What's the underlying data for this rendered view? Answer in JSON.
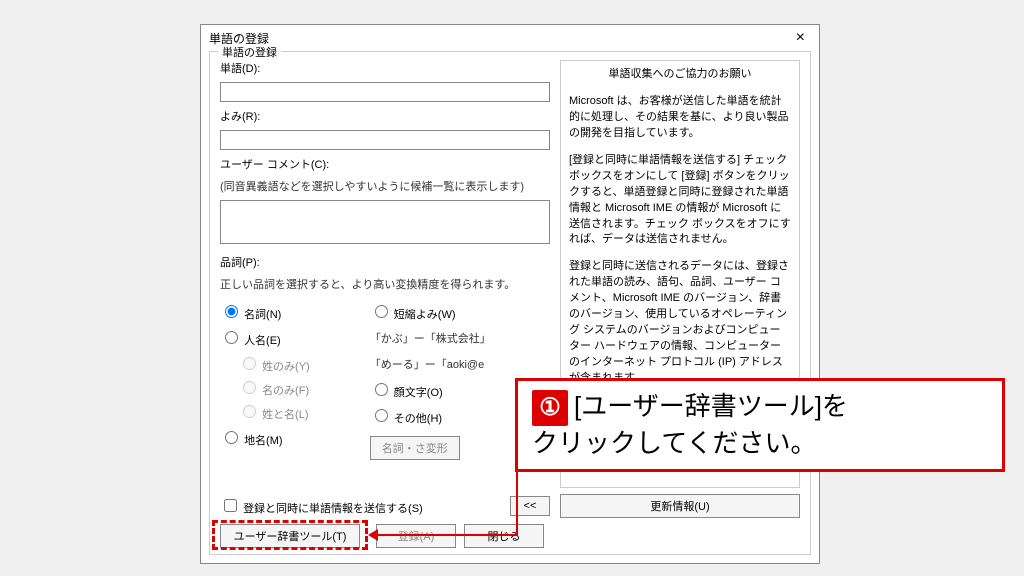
{
  "dialog": {
    "title": "単語の登録",
    "group_title": "単語の登録",
    "word_label": "単語(D):",
    "word_value": "",
    "reading_label": "よみ(R):",
    "reading_value": "",
    "comment_label": "ユーザー コメント(C):",
    "comment_hint": "(同音異義語などを選択しやすいように候補一覧に表示します)",
    "comment_value": "",
    "pos_label": "品詞(P):",
    "pos_hint": "正しい品詞を選択すると、より高い変換精度を得られます。",
    "pos": {
      "noun": "名詞(N)",
      "person": "人名(E)",
      "surname_only": "姓のみ(Y)",
      "given_only": "名のみ(F)",
      "full_name": "姓と名(L)",
      "place": "地名(M)",
      "short": "短縮よみ(W)",
      "example1": "「かぶ」ー「株式会社」",
      "example2": "「めーる」ー「aoki@e",
      "emoji": "顔文字(O)",
      "other": "その他(H)",
      "inflect_btn": "名詞・さ変形"
    },
    "info_title": "単語収集へのご協力のお願い",
    "info_p1": "Microsoft は、お客様が送信した単語を統計的に処理し、その結果を基に、より良い製品の開発を目指しています。",
    "info_p2": "[登録と同時に単語情報を送信する] チェック ボックスをオンにして [登録] ボタンをクリックすると、単語登録と同時に登録された単語情報と Microsoft IME の情報が Microsoft に送信されます。チェック ボックスをオフにすれば、データは送信されません。",
    "info_p3": "登録と同時に送信されるデータには、登録された単語の読み、語句、品詞、ユーザー コメント、Microsoft IME のバージョン、辞書のバージョン、使用しているオペレーティング システムのバージョンおよびコンピューター ハードウェアの情報、コンピューターのインターネット プロトコル (IP) アドレスが含まれます。",
    "send_checkbox": "登録と同時に単語情報を送信する(S)",
    "prev_btn": "<<",
    "update_btn": "更新情報(U)",
    "user_dict_btn": "ユーザー辞書ツール(T)",
    "register_btn": "登録(A)",
    "close_btn": "閉じる"
  },
  "annotation": {
    "number": "①",
    "text_line1": "[ユーザー辞書ツール]を",
    "text_line2": "クリックしてください。"
  }
}
